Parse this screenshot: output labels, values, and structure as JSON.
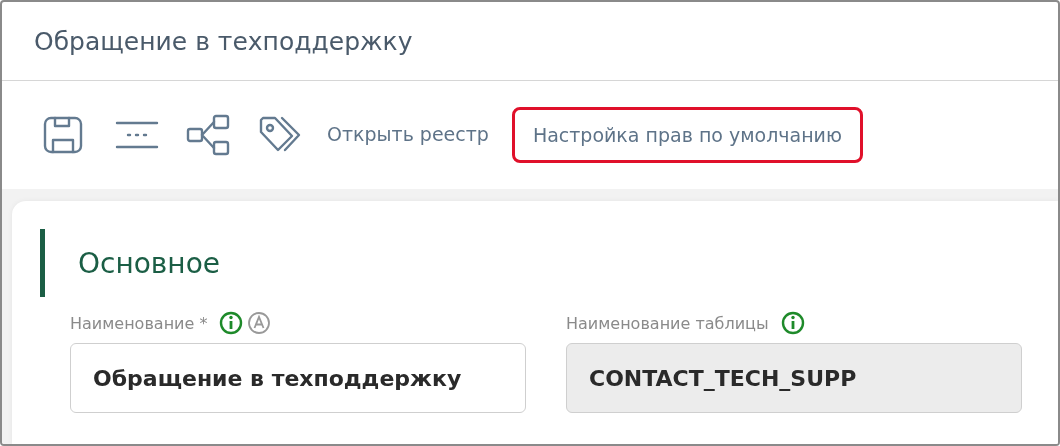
{
  "window": {
    "title": "Обращение в техподдержку"
  },
  "toolbar": {
    "icons": [
      {
        "kind": "save"
      },
      {
        "kind": "more"
      },
      {
        "kind": "share"
      },
      {
        "kind": "tags"
      }
    ],
    "links": [
      {
        "label": "Открыть реестр",
        "highlighted": false
      },
      {
        "label": "Настройка прав по умолчанию",
        "highlighted": true
      }
    ]
  },
  "section": {
    "title": "Основное",
    "fields": [
      {
        "label": "Наименование *",
        "value": "Обращение в техподдержку",
        "disabled": false,
        "icons": [
          {
            "kind": "info"
          },
          {
            "kind": "auto"
          }
        ]
      },
      {
        "label": "Наименование таблицы",
        "value": "CONTACT_TECH_SUPP",
        "disabled": true,
        "icons": [
          {
            "kind": "info"
          }
        ]
      }
    ]
  }
}
